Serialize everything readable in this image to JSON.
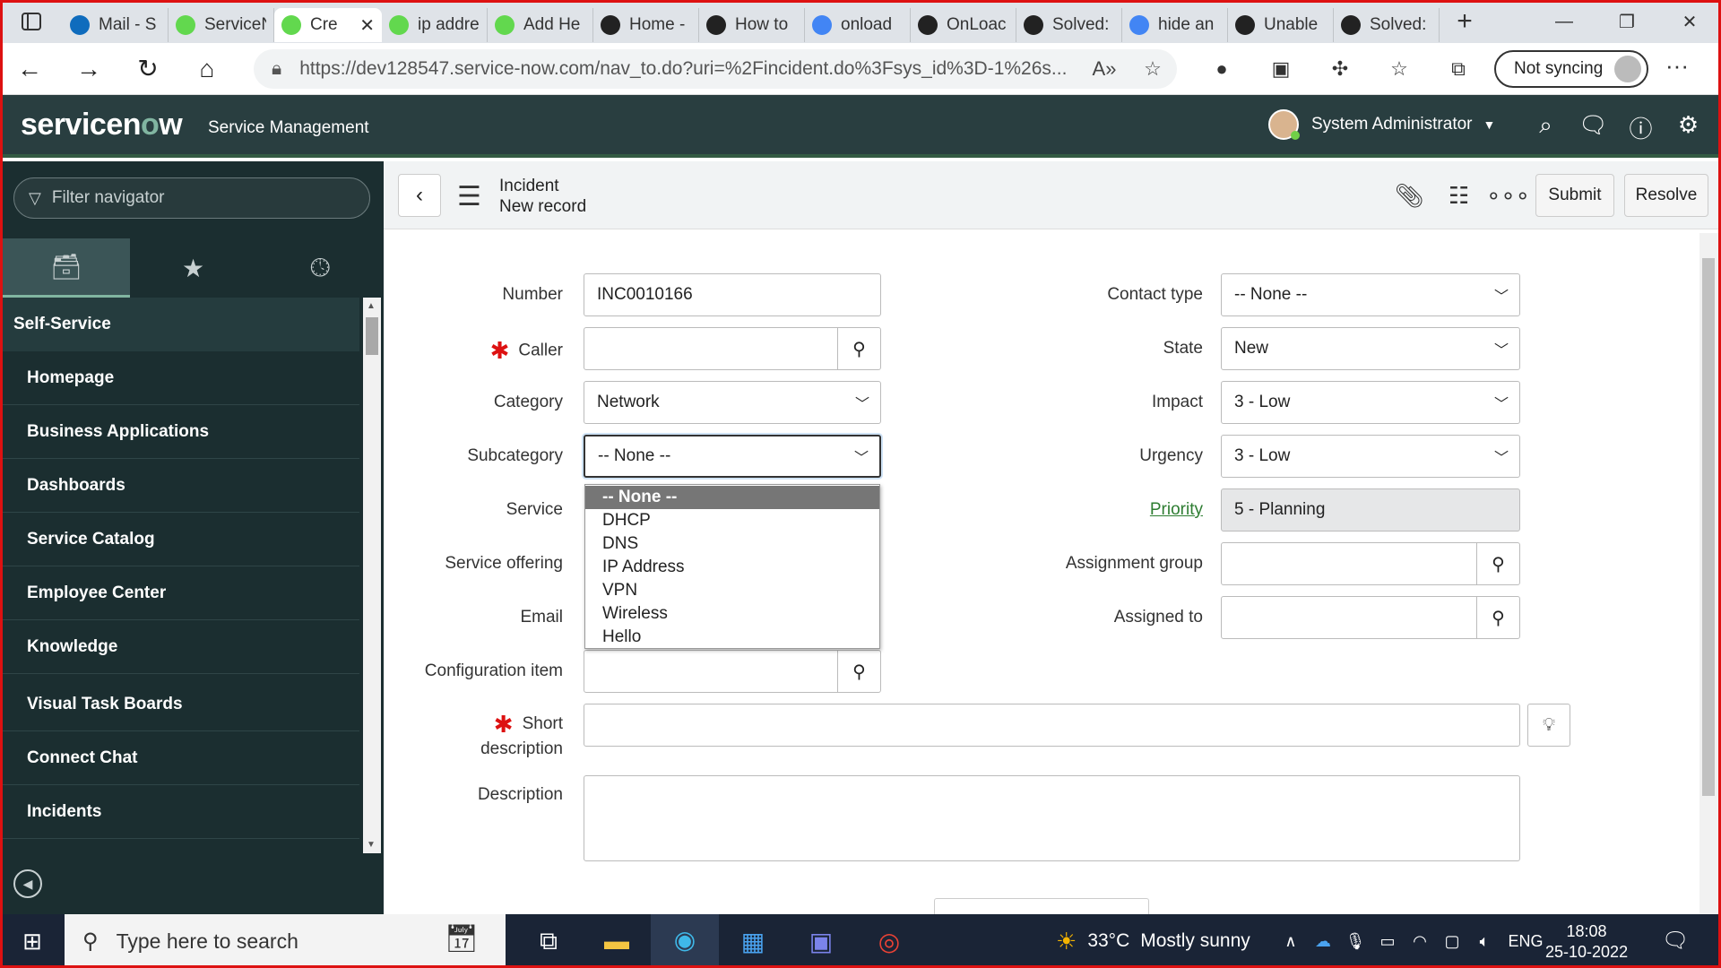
{
  "browser": {
    "tabs": [
      {
        "title": "Mail - S",
        "color": "#0f6cbd"
      },
      {
        "title": "ServiceN",
        "color": "#62d84e"
      },
      {
        "title": "Cre",
        "color": "#62d84e",
        "active": true
      },
      {
        "title": "ip addre",
        "color": "#62d84e"
      },
      {
        "title": "Add He",
        "color": "#62d84e"
      },
      {
        "title": "Home -",
        "color": "#222"
      },
      {
        "title": "How to",
        "color": "#222"
      },
      {
        "title": "onload",
        "color": "#4285f4"
      },
      {
        "title": "OnLoac",
        "color": "#222"
      },
      {
        "title": "Solved:",
        "color": "#222"
      },
      {
        "title": "hide an",
        "color": "#4285f4"
      },
      {
        "title": "Unable",
        "color": "#222"
      },
      {
        "title": "Solved:",
        "color": "#222"
      }
    ],
    "url": "https://dev128547.service-now.com/nav_to.do?uri=%2Fincident.do%3Fsys_id%3D-1%26s...",
    "sync_label": "Not syncing"
  },
  "header": {
    "logo_text_1": "servicen",
    "logo_text_o": "o",
    "logo_text_2": "w",
    "app_name": "Service Management",
    "user_name": "System Administrator"
  },
  "navigator": {
    "filter_placeholder": "Filter navigator",
    "section": "Self-Service",
    "items": [
      "Homepage",
      "Business Applications",
      "Dashboards",
      "Service Catalog",
      "Employee Center",
      "Knowledge",
      "Visual Task Boards",
      "Connect Chat",
      "Incidents"
    ]
  },
  "form": {
    "title": "Incident",
    "subtitle": "New record",
    "submit_label": "Submit",
    "resolve_label": "Resolve",
    "labels": {
      "number": "Number",
      "caller": "Caller",
      "category": "Category",
      "subcategory": "Subcategory",
      "service": "Service",
      "service_offering": "Service offering",
      "email": "Email",
      "configuration_item": "Configuration item",
      "short_desc_1": "Short",
      "short_desc_2": "description",
      "description": "Description",
      "contact_type": "Contact type",
      "state": "State",
      "impact": "Impact",
      "urgency": "Urgency",
      "priority": "Priority",
      "assignment_group": "Assignment group",
      "assigned_to": "Assigned to"
    },
    "values": {
      "number": "INC0010166",
      "category": "Network",
      "subcategory": "-- None --",
      "contact_type": "-- None --",
      "state": "New",
      "impact": "3 - Low",
      "urgency": "3 - Low",
      "priority": "5 - Planning"
    },
    "subcategory_options": [
      "-- None --",
      "DHCP",
      "DNS",
      "IP Address",
      "VPN",
      "Wireless",
      "Hello"
    ]
  },
  "taskbar": {
    "search_placeholder": "Type here to search",
    "weather_temp": "33°C",
    "weather_text": "Mostly sunny",
    "lang": "ENG",
    "time": "18:08",
    "date": "25-10-2022"
  }
}
